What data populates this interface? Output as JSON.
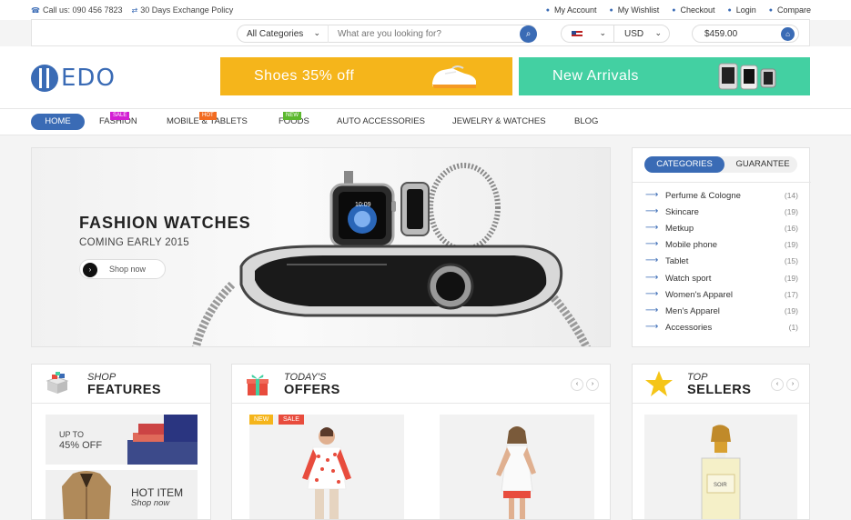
{
  "topbar": {
    "phone": "Call us: 090 456 7823",
    "policy": "30 Days Exchange Policy",
    "links": [
      "My Account",
      "My Wishlist",
      "Checkout",
      "Login",
      "Compare"
    ]
  },
  "search": {
    "category": "All Categories",
    "placeholder": "What are you looking for?",
    "currency": "USD",
    "cart_total": "$459.00"
  },
  "logo": {
    "text": "EDO"
  },
  "banners": [
    {
      "label": "Shoes 35% off",
      "color": "#f5b51b"
    },
    {
      "label": "New Arrivals",
      "color": "#43d0a2"
    }
  ],
  "nav": {
    "items": [
      "HOME",
      "FASHION",
      "MOBILE & TABLETS",
      "FOODS",
      "AUTO ACCESSORIES",
      "JEWELRY & WATCHES",
      "BLOG"
    ],
    "badges": {
      "sale": "SALE",
      "hot": "HOT",
      "new": "NEW"
    }
  },
  "hero": {
    "title": "FASHION WATCHES",
    "subtitle": "COMING EARLY 2015",
    "button": "Shop now",
    "watch_time": "10:09"
  },
  "categories": {
    "tabs": [
      "CATEGORIES",
      "GUARANTEE"
    ],
    "items": [
      {
        "name": "Perfume & Cologne",
        "count": "(14)"
      },
      {
        "name": "Skincare",
        "count": "(19)"
      },
      {
        "name": "Metkup",
        "count": "(16)"
      },
      {
        "name": "Mobile phone",
        "count": "(19)"
      },
      {
        "name": "Tablet",
        "count": "(15)"
      },
      {
        "name": "Watch sport",
        "count": "(19)"
      },
      {
        "name": "Women's Apparel",
        "count": "(17)"
      },
      {
        "name": "Men's Apparel",
        "count": "(19)"
      },
      {
        "name": "Accessories",
        "count": "(1)"
      }
    ]
  },
  "features": {
    "pre": "SHOP",
    "title": "FEATURES",
    "promo1_line1": "UP TO",
    "promo1_line2": "45% OFF",
    "promo2_line1": "HOT ITEM",
    "promo2_line2": "Shop now"
  },
  "offers": {
    "pre": "TODAY'S",
    "title": "OFFERS",
    "tag_new": "NEW",
    "tag_sale": "SALE"
  },
  "sellers": {
    "pre": "TOP",
    "title": "SELLERS",
    "perfume_label": "SOIR"
  },
  "colors": {
    "accent": "#3a6bb5",
    "sale": "#d31fd3",
    "hot": "#f26b21",
    "new": "#5cb82e"
  }
}
